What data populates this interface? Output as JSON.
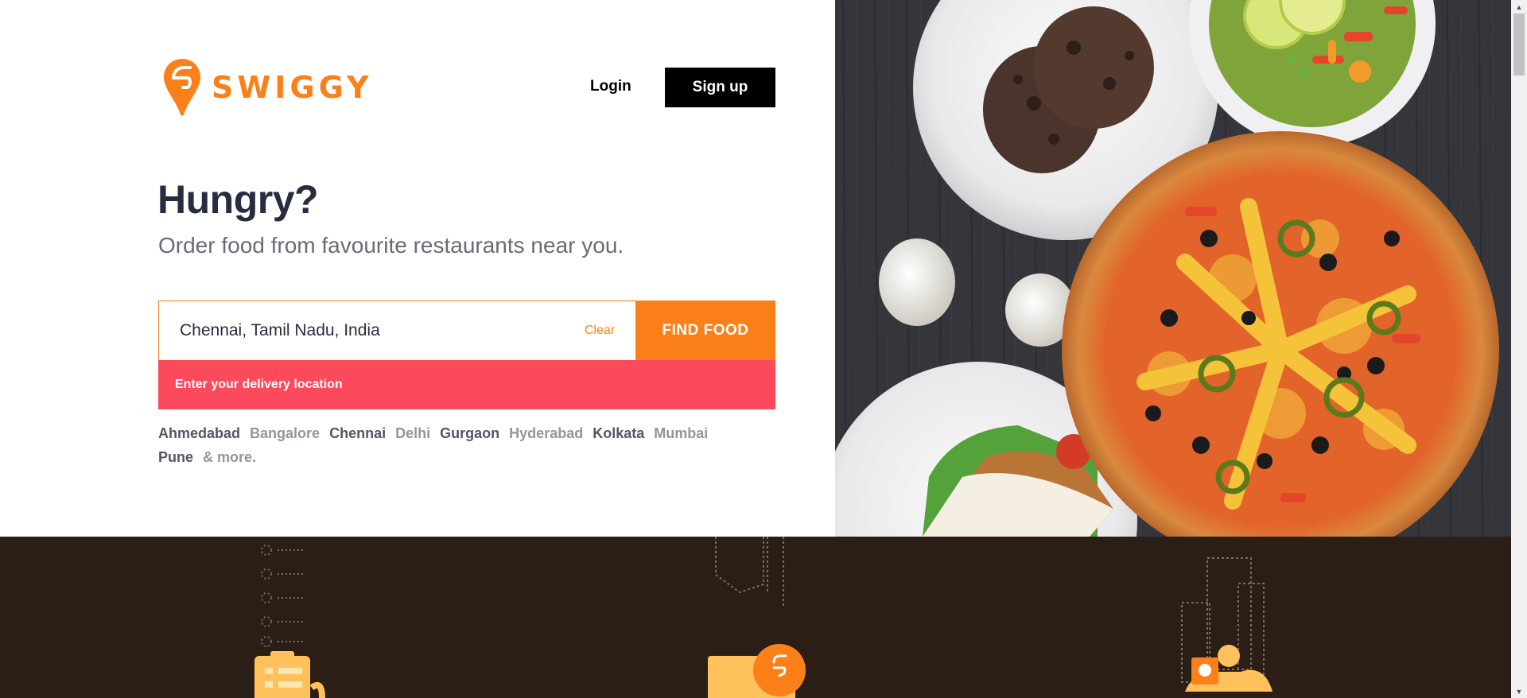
{
  "brand": {
    "name": "SWIGGY",
    "color": "#fc8019"
  },
  "header": {
    "login_label": "Login",
    "signup_label": "Sign up"
  },
  "hero": {
    "headline": "Hungry?",
    "subheadline": "Order food from favourite restaurants near you."
  },
  "search": {
    "value": "Chennai, Tamil Nadu, India",
    "clear_label": "Clear",
    "button_label": "FIND FOOD",
    "error_message": "Enter your delivery location"
  },
  "cities": [
    {
      "name": "Ahmedabad",
      "tone": "dark"
    },
    {
      "name": "Bangalore",
      "tone": "light"
    },
    {
      "name": "Chennai",
      "tone": "dark"
    },
    {
      "name": "Delhi",
      "tone": "light"
    },
    {
      "name": "Gurgaon",
      "tone": "dark"
    },
    {
      "name": "Hyderabad",
      "tone": "light"
    },
    {
      "name": "Kolkata",
      "tone": "dark"
    },
    {
      "name": "Mumbai",
      "tone": "light"
    },
    {
      "name": "Pune",
      "tone": "dark"
    }
  ],
  "more_cities_label": "& more.",
  "colors": {
    "accent": "#fc8019",
    "error": "#fa4a5b",
    "footer_bg": "#2b1e16",
    "heading": "#282c3f"
  },
  "icons": [
    "swiggy-logo-icon",
    "food-image",
    "order-list-icon",
    "delivery-box-icon",
    "delivery-scooter-icon"
  ]
}
